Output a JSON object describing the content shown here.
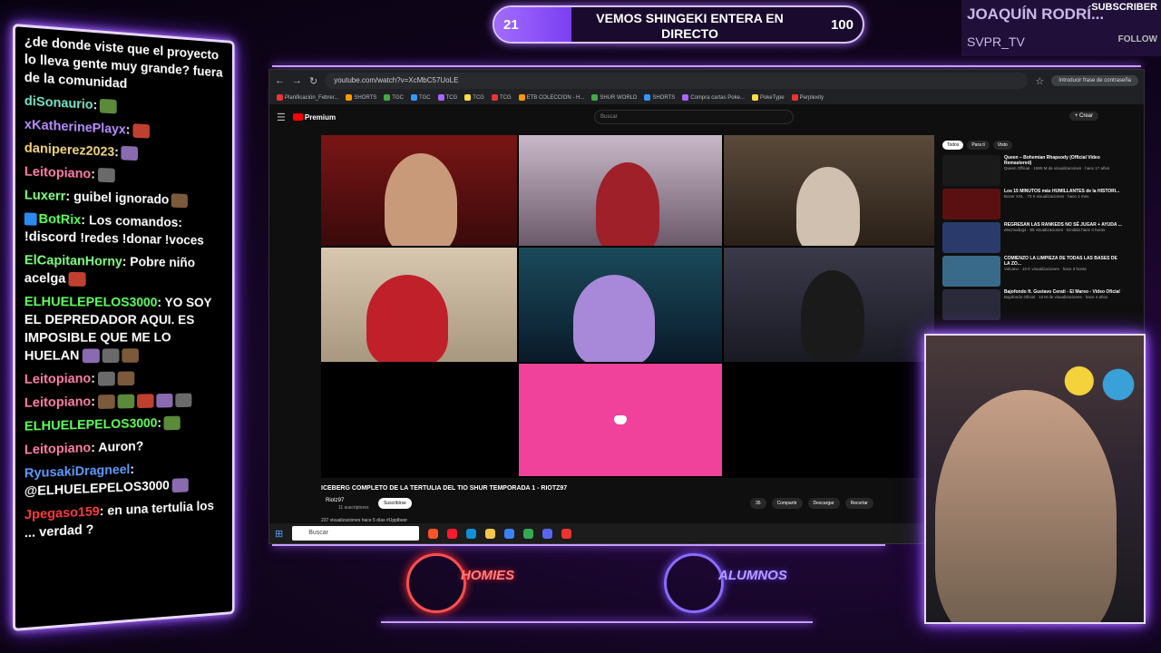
{
  "goal": {
    "current": "21",
    "title": "VEMOS SHINGEKI ENTERA EN DIRECTO",
    "target": "100",
    "progress": 0.21
  },
  "subscriber": {
    "name": "JOAQUÍN RODRÍ...",
    "label": "SUBSCRIBER",
    "handle": "SVPR_TV",
    "follow_label": "FOLLOW"
  },
  "chat": {
    "messages": [
      {
        "user": "",
        "text": "¿de donde viste que el proyecto lo lleva gente muy grande? fuera de la comunidad",
        "color": "#ffffff",
        "emotes": 0
      },
      {
        "user": "diSonaurio",
        "text": ":",
        "color": "#7ae3c6",
        "emotes": 1
      },
      {
        "user": "xKatherinePlayx",
        "text": ":",
        "color": "#b78cff",
        "emotes": 1
      },
      {
        "user": "daniperez2023",
        "text": ":",
        "color": "#f3d47a",
        "emotes": 1
      },
      {
        "user": "Leitopiano",
        "text": ":",
        "color": "#ff7fa8",
        "emotes": 1
      },
      {
        "user": "Luxerr",
        "text": ": guibel ignorado",
        "color": "#7fff7f",
        "emotes": 1
      },
      {
        "user": "BotRix",
        "text": ": Los comandos: !discord !redes !donar !voces",
        "color": "#5cff5c",
        "emotes": 0,
        "badge": true
      },
      {
        "user": "ElCapitanHorny",
        "text": ": Pobre niño acelga",
        "color": "#7fff7f",
        "emotes": 1
      },
      {
        "user": "ELHUELEPELOS3000",
        "text": ": YO SOY EL DEPREDADOR AQUI. ES IMPOSIBLE QUE ME LO HUELAN",
        "color": "#5cff5c",
        "emotes": 3
      },
      {
        "user": "Leitopiano",
        "text": ":",
        "color": "#ff7fa8",
        "emotes": 2
      },
      {
        "user": "Leitopiano",
        "text": ":",
        "color": "#ff7fa8",
        "emotes": 5
      },
      {
        "user": "ELHUELEPELOS3000",
        "text": ":",
        "color": "#5cff5c",
        "emotes": 1
      },
      {
        "user": "Leitopiano",
        "text": ": Auron?",
        "color": "#ff7fa8",
        "emotes": 0
      },
      {
        "user": "RyusakiDragneel",
        "text": ": @ELHUELEPELOS3000",
        "color": "#5d9bff",
        "emotes": 1
      },
      {
        "user": "Jpegaso159",
        "text": ": en una tertulia los ... verdad ?",
        "color": "#ff3b3b",
        "emotes": 0
      }
    ]
  },
  "browser": {
    "url": "youtube.com/watch?v=XcMbC57UoLE",
    "password_hint": "Introducir frase de contraseña",
    "bookmarks": [
      "Planificación_Febrer...",
      "SHORTS",
      "TGC",
      "TGC",
      "TCG",
      "TCG",
      "TCG",
      "ETB COLECCION - H...",
      "SHUR WORLD",
      "SHORTS",
      "Compra cartas Poke...",
      "PokeType",
      "Perplexity"
    ],
    "yt_logo": "Premium",
    "search_placeholder": "Buscar",
    "create_label": "+ Crear",
    "video_title": "ICEBERG COMPLETO DE LA TERTULIA DEL TIO SHUR TEMPORADA 1 - RIOTZ97",
    "channel": "Riotz97",
    "channel_subs": "11 suscriptores",
    "subscribe_label": "Suscribirse",
    "actions": [
      "35",
      "Compartir",
      "Descargar",
      "Recortar"
    ],
    "views_line": "237 visualizaciones hace 5 días #Upplbeer",
    "chips": [
      "Todos",
      "Para ti",
      "Visto"
    ],
    "recommendations": [
      {
        "title": "Queen – Bohemian Rhapsody (Official Video Remastered)",
        "meta": "Queen Official · 1599 M de visualizaciones · hace 17 años"
      },
      {
        "title": "Los 15 MINUTOS más HUMILLANTES de la HISTORI...",
        "meta": "Bozer XXL · 73 K visualizaciones · hace 1 mes"
      },
      {
        "title": "REGRESAN LAS RANKEDS NO SÉ JUGAR + AYUDA ...",
        "meta": "elecmodog4 · 85 visualizaciones · Emitido hace 3 horas"
      },
      {
        "title": "COMIENZO LA LIMPIEZA DE TODAS LAS BASES DE LA ZO...",
        "meta": "Volcano · 10 K visualizaciones · hace 3 horas"
      },
      {
        "title": "Bajofondo ft. Gustavo Cerati - El Mareo - Video Oficial",
        "meta": "Bajofondo Oficial · 13 M de visualizaciones · hace 4 años"
      }
    ],
    "taskbar_search": "Buscar"
  },
  "teams": {
    "left": "HOMIES",
    "right": "ALUMNOS"
  },
  "colors": {
    "neon": "#b37cff",
    "goal_fill": "#8b4dff",
    "discord": "#f0419b"
  }
}
